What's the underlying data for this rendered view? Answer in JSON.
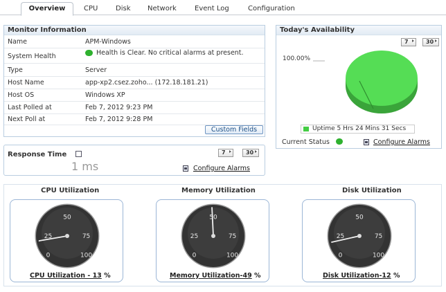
{
  "tabs": [
    {
      "label": "Overview",
      "active": true
    },
    {
      "label": "CPU"
    },
    {
      "label": "Disk"
    },
    {
      "label": "Network"
    },
    {
      "label": "Event Log"
    },
    {
      "label": "Configuration"
    }
  ],
  "monitor": {
    "title": "Monitor Information",
    "rows": [
      {
        "key": "Name",
        "value": "APM-Windows"
      },
      {
        "key": "System Health",
        "value": "Health is Clear. No critical alarms at present."
      },
      {
        "key": "Type",
        "value": "Server"
      },
      {
        "key": "Host Name",
        "value": "app-xp2.csez.zoho... (172.18.181.21)"
      },
      {
        "key": "Host OS",
        "value": "Windows XP"
      },
      {
        "key": "Last Polled at",
        "value": "Feb 7, 2012 9:23 PM"
      },
      {
        "key": "Next Poll at",
        "value": "Feb 7, 2012 9:28 PM"
      }
    ],
    "custom_fields_label": "Custom Fields"
  },
  "response": {
    "title": "Response Time",
    "value": "1 ms",
    "btn7": "7",
    "btn30": "30",
    "configure": "Configure Alarms"
  },
  "availability": {
    "title": "Today's Availability",
    "btn7": "7",
    "btn30": "30",
    "pie_label": "100.00%",
    "uptime_percent": 100,
    "legend": "Uptime 5 Hrs 24 Mins 31 Secs",
    "current_status_label": "Current Status",
    "configure": "Configure Alarms",
    "color": "#55dd55"
  },
  "gauges": [
    {
      "title": "CPU Utilization",
      "caption": "CPU Utilization - 13",
      "unit": "%",
      "value": 13,
      "ticks": [
        "0",
        "25",
        "50",
        "75",
        "100"
      ]
    },
    {
      "title": "Memory Utilization",
      "caption": "Memory Utilization-49",
      "unit": "%",
      "value": 49,
      "ticks": [
        "0",
        "25",
        "50",
        "75",
        "100"
      ]
    },
    {
      "title": "Disk Utilization",
      "caption": "Disk Utilization-12",
      "unit": "%",
      "value": 12,
      "ticks": [
        "0",
        "25",
        "50",
        "75",
        "100"
      ]
    }
  ],
  "icons": {
    "health": "green-status-icon",
    "configure": "configure-alarms-icon",
    "response_popup": "popup-icon"
  }
}
